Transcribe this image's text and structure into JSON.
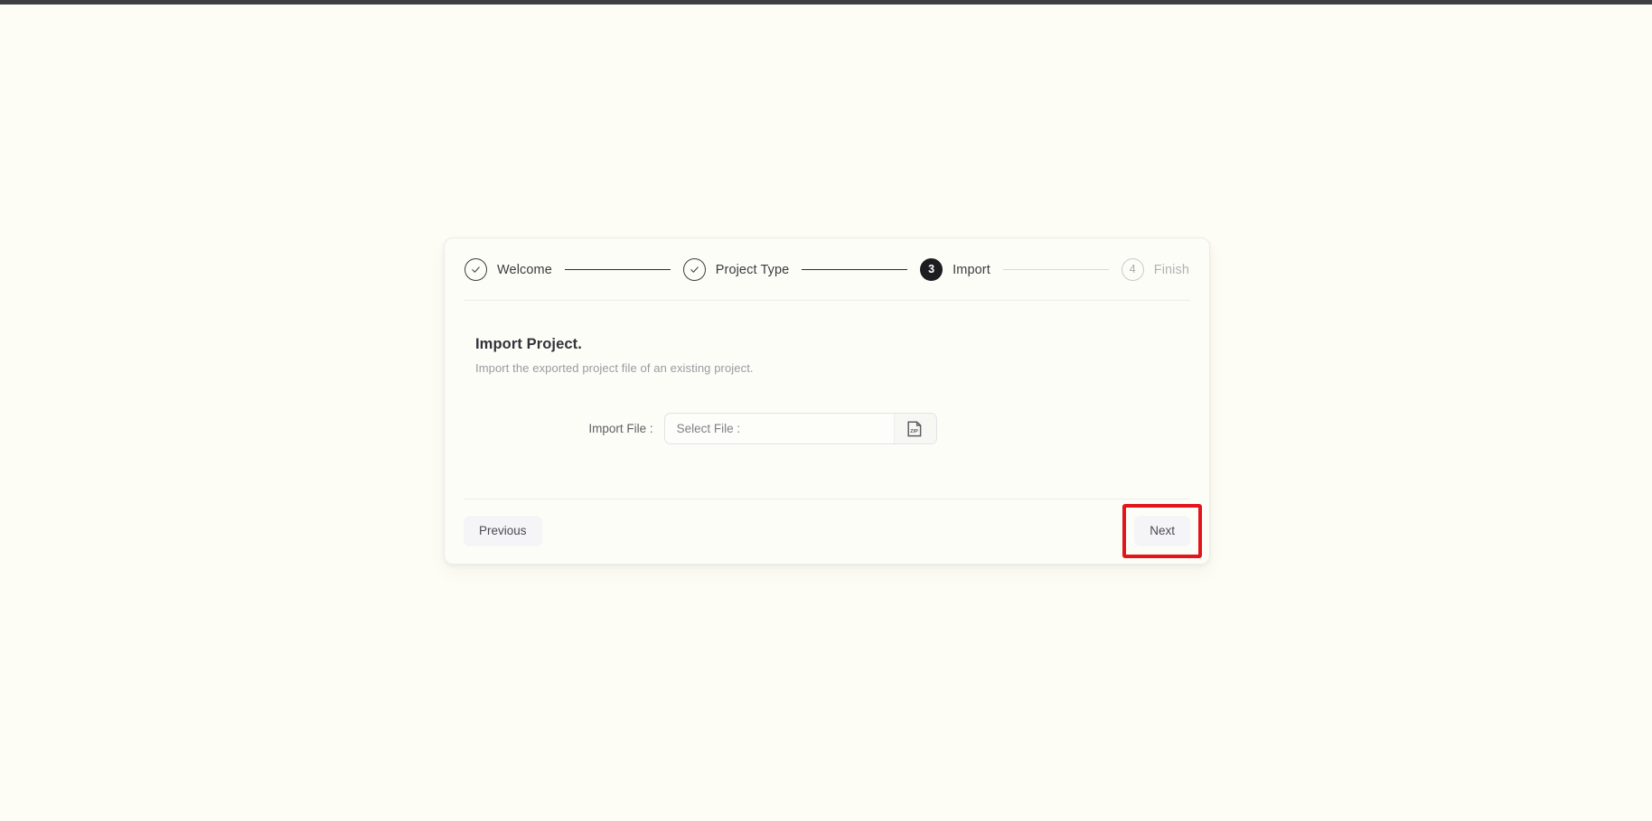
{
  "app": {
    "background_color": "#fdfdf5",
    "accent_color": "#1d1d21",
    "highlight_color": "#e3141b"
  },
  "wizard": {
    "stepper": {
      "steps": [
        {
          "label": "Welcome",
          "marker": "✓",
          "state": "done"
        },
        {
          "label": "Project Type",
          "marker": "✓",
          "state": "done"
        },
        {
          "label": "Import",
          "marker": "3",
          "state": "active"
        },
        {
          "label": "Finish",
          "marker": "4",
          "state": "pending"
        }
      ]
    },
    "body": {
      "title": "Import Project.",
      "subtitle": "Import the exported project file of an existing project.",
      "field": {
        "label": "Import File :",
        "value": "Select File :",
        "placeholder": "Select File :",
        "browse_icon": "zip-file-icon"
      }
    },
    "footer": {
      "previous_label": "Previous",
      "next_label": "Next"
    }
  }
}
